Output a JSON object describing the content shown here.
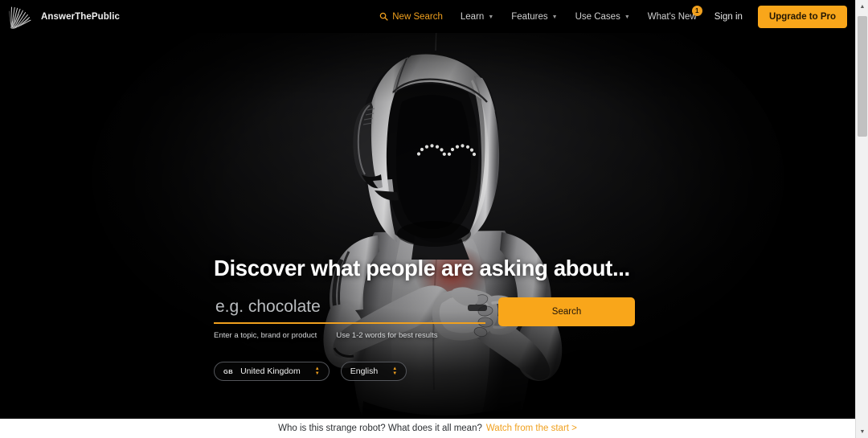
{
  "brand": {
    "name": "AnswerThePublic",
    "logo_icon": "fan-burst-logo-icon"
  },
  "colors": {
    "accent": "#f9a61a",
    "accent_text": "#f0a01e",
    "header_bg": "#000000",
    "hero_bg": "#040404",
    "notice_bg": "#ffffff",
    "notice_text": "#2c2f33",
    "pill_border": "#53555a"
  },
  "nav": {
    "items": [
      {
        "label": "New Search",
        "icon": "search-icon",
        "accent": true,
        "caret": false,
        "badge": null
      },
      {
        "label": "Learn",
        "icon": null,
        "accent": false,
        "caret": true,
        "badge": null
      },
      {
        "label": "Features",
        "icon": null,
        "accent": false,
        "caret": true,
        "badge": null
      },
      {
        "label": "Use Cases",
        "icon": null,
        "accent": false,
        "caret": true,
        "badge": null
      },
      {
        "label": "What's New",
        "icon": null,
        "accent": false,
        "caret": false,
        "badge": "1"
      }
    ],
    "caret_glyph": "▼",
    "sign_in_label": "Sign in",
    "upgrade_label": "Upgrade to Pro"
  },
  "hero": {
    "title": "Discover what people are asking about...",
    "search": {
      "value": "",
      "placeholder": "e.g. chocolate",
      "button_label": "Search"
    },
    "hints": [
      "Enter a topic, brand or product",
      "Use 1-2 words for best results"
    ],
    "selectors": [
      {
        "flag": "GB",
        "label": "United Kingdom",
        "name": "country"
      },
      {
        "flag": "",
        "label": "English",
        "name": "language"
      }
    ],
    "background_image": "robot-holding-mug-dark-photo"
  },
  "notice": {
    "text": "Who is this strange robot? What does it all mean?",
    "link_label": "Watch from the start >"
  },
  "scrollbar": {
    "up_arrow": "▲",
    "down_arrow": "▼"
  }
}
